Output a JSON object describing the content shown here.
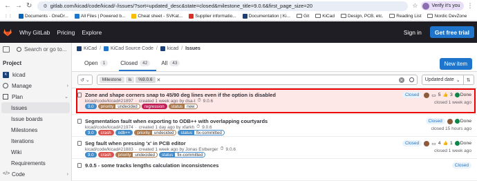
{
  "browser": {
    "url": "gitlab.com/kicad/code/kicad/-/issues/?sort=updated_desc&state=closed&milestone_title=9.0.6&first_page_size=20",
    "profile_label": "Verify it's you",
    "bookmarks": [
      {
        "label": "Documents - OneDr...",
        "color": "#0364b8"
      },
      {
        "label": "All Files | Powered b...",
        "color": "#1f75cb"
      },
      {
        "label": "Cheat sheet - SVKat...",
        "color": "#fbbc04"
      },
      {
        "label": "Supplier informatio...",
        "color": "#d93025"
      },
      {
        "label": "Documentation | Ki...",
        "color": "#1c3f75"
      },
      {
        "label": "Git",
        "color": "folder"
      },
      {
        "label": "KiCad",
        "color": "folder"
      },
      {
        "label": "Design, PCB, etc.",
        "color": "folder"
      },
      {
        "label": "Reading List",
        "color": "folder"
      },
      {
        "label": "Nordic DevZone",
        "color": "folder"
      }
    ]
  },
  "header": {
    "nav": [
      "Why GitLab",
      "Pricing",
      "Explore"
    ],
    "sign_in": "Sign in",
    "free_trial": "Get free trial"
  },
  "sidebar": {
    "search": "Search or go to...",
    "section": "Project",
    "project": "kicad",
    "items": [
      "Manage",
      "Plan"
    ],
    "plan_sub": [
      "Issues",
      "Issue boards",
      "Milestones",
      "Iterations",
      "Wiki",
      "Requirements"
    ],
    "code": "Code"
  },
  "breadcrumb": [
    "KiCad",
    "KiCad Source Code",
    "kicad",
    "Issues"
  ],
  "tabs": [
    {
      "label": "Open",
      "count": "1"
    },
    {
      "label": "Closed",
      "count": "42"
    },
    {
      "label": "All",
      "count": "43"
    }
  ],
  "new_item": "New item",
  "filter": {
    "field": "Milestone",
    "op": "is",
    "value": "%9.0.6",
    "sort_label": "Updated date"
  },
  "issues": [
    {
      "title": "Zone and shape corners snap to 45/90 deg lines even if the option is disabled",
      "ref": "kicad/code/kicad#21897",
      "created": "created 1 week ago by dsa-t",
      "milestone": "9.0.6",
      "labels": [
        {
          "text": "9.0",
          "type": "plain",
          "bg": "#428bca"
        },
        {
          "k": "priority",
          "v": "undecided",
          "type": "split",
          "kbg": "#a8794f",
          "vbg": "#fff"
        },
        {
          "text": "regression",
          "type": "plain",
          "bg": "#c21e56"
        },
        {
          "k": "status",
          "v": "new",
          "type": "split",
          "kbg": "#a8794f",
          "vbg": "#fff"
        }
      ],
      "state": "Closed",
      "comments": "5",
      "upvotes": "3",
      "done": "Done",
      "updated": "closed 1 week ago"
    },
    {
      "title": "Segmentation fault when exporting to ODB++ with overlapping courtyards",
      "ref": "kicad/code/kicad#21974",
      "created": "created 1 day ago by xfarkh",
      "milestone": "9.0.6",
      "labels": [
        {
          "text": "9.0",
          "type": "plain",
          "bg": "#428bca"
        },
        {
          "text": "crash",
          "type": "plain",
          "bg": "#d9534f"
        },
        {
          "text": "odb++",
          "type": "plain",
          "bg": "#428bca"
        },
        {
          "k": "priority",
          "v": "undecided",
          "type": "split",
          "kbg": "#a8794f",
          "vbg": "#fff"
        },
        {
          "k": "status",
          "v": "fix-committed",
          "type": "split",
          "kbg": "#428bca",
          "vbg": "#fff"
        }
      ],
      "state": "Closed",
      "comments": "",
      "upvotes": "",
      "done": "Done",
      "updated": "closed 15 hours ago"
    },
    {
      "title": "Seg fault when pressing 'x' in PCB editor",
      "ref": "kicad/code/kicad#21883",
      "created": "created 1 week ago by Jonas Estberger",
      "milestone": "9.0.6",
      "labels": [
        {
          "text": "9.0",
          "type": "plain",
          "bg": "#428bca"
        },
        {
          "text": "crash",
          "type": "plain",
          "bg": "#d9534f"
        },
        {
          "k": "priority",
          "v": "undecided",
          "type": "split",
          "kbg": "#a8794f",
          "vbg": "#fff"
        },
        {
          "k": "status",
          "v": "fix-committed",
          "type": "split",
          "kbg": "#428bca",
          "vbg": "#fff"
        }
      ],
      "state": "Closed",
      "comments": "4",
      "upvotes": "1",
      "done": "Done",
      "updated": "closed 1 week ago"
    },
    {
      "title": "9.0.5 - some tracks lengths calculation inconsistences",
      "ref": "",
      "created": "",
      "milestone": "",
      "labels": [],
      "state": "Closed",
      "comments": "",
      "upvotes": "",
      "done": "",
      "updated": ""
    }
  ]
}
